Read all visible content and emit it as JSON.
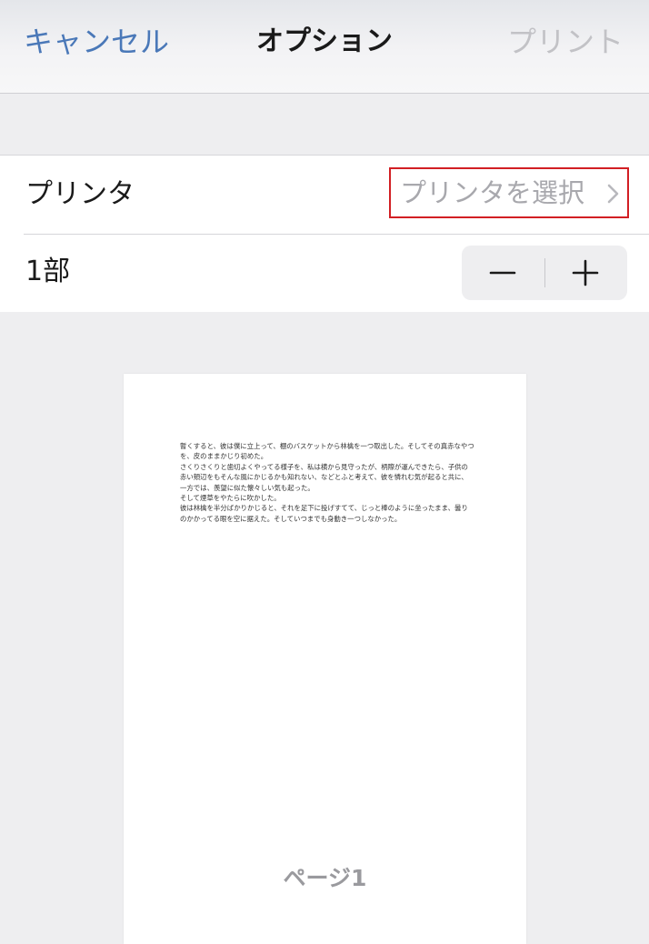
{
  "navbar": {
    "cancel_label": "キャンセル",
    "title": "オプション",
    "print_label": "プリント"
  },
  "printer_row": {
    "label": "プリンタ",
    "value": "プリンタを選択",
    "icon": "chevron-right-icon"
  },
  "copies_row": {
    "label": "1部",
    "stepper": {
      "minus_icon": "minus-icon",
      "plus_icon": "plus-icon"
    }
  },
  "preview": {
    "paragraphs": [
      "暫くすると、彼は僕に立上って、棚のバスケットから林檎を一つ取出した。そしてその真赤なやつを、皮のままかじり初めた。",
      "さくりさくりと歯切よくやってる様子を、私は横から見守ったが、柄際が運んできたら、子供の赤い頬辺をもそんな風にかじるかも知れない、などとふと考えて、彼を憐れむ気が起ると共に、一方では、羨望に似た懐々しい気も起った。",
      "そして煙草をやたらに吹かした。",
      "彼は林檎を半分ばかりかじると、それを足下に投げすてて、じっと棒のように坐ったまま、曇りのかかってる眼を空に据えた。そしていつまでも身動き一つしなかった。"
    ],
    "page_label": "ページ1"
  },
  "colors": {
    "accent": "#4a78b8",
    "disabled": "#c2c2c6",
    "highlight_border": "#d21f24"
  }
}
